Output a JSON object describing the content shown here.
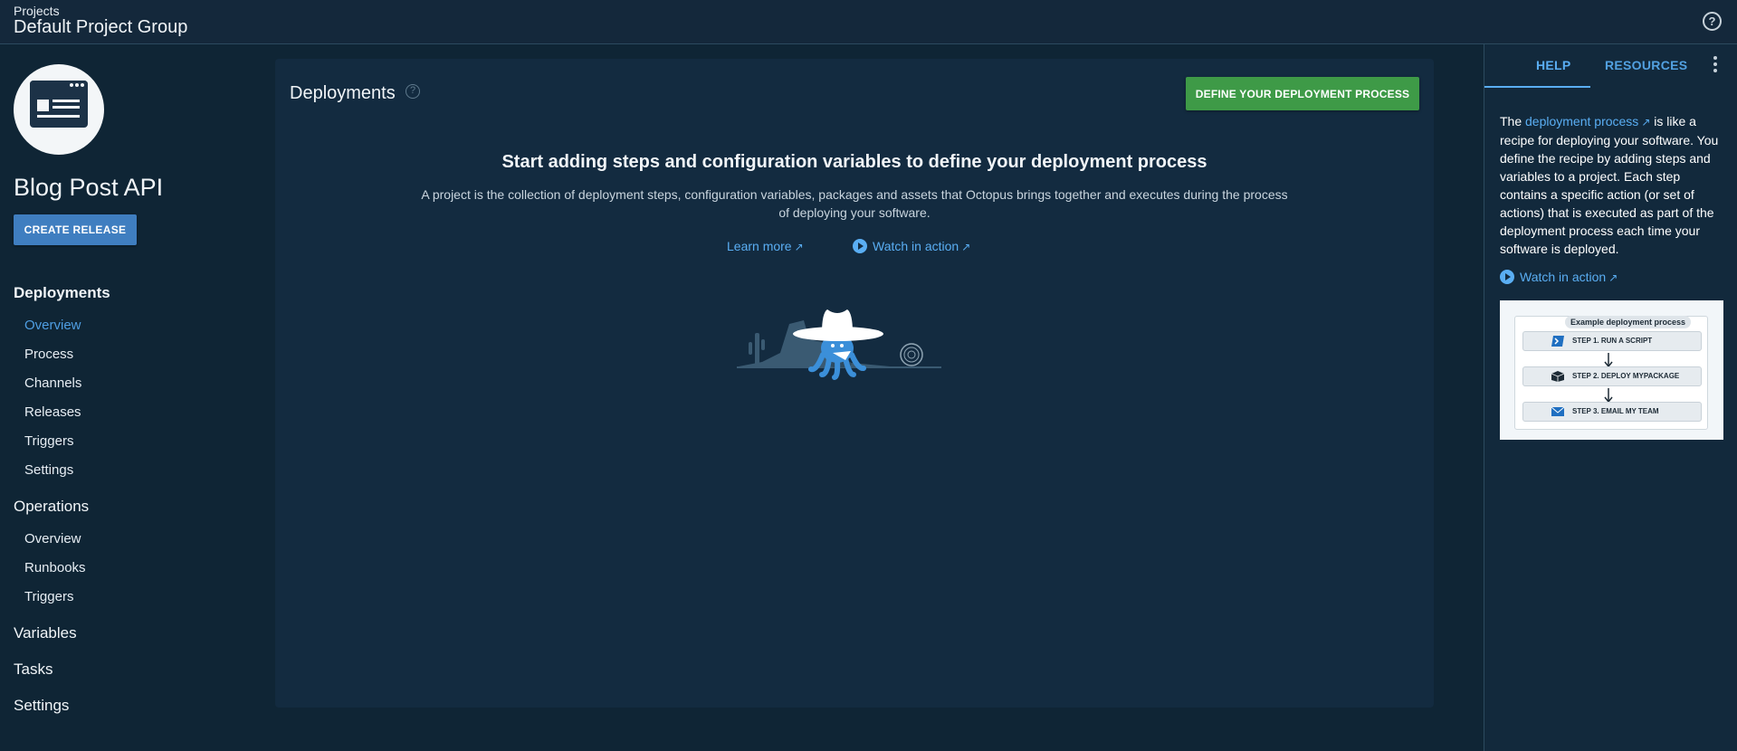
{
  "header": {
    "breadcrumb": "Projects",
    "title": "Default Project Group",
    "help_icon": "question-circle-icon"
  },
  "sidebar": {
    "project_name": "Blog Post API",
    "create_release_label": "CREATE RELEASE",
    "groups": {
      "deployments": "Deployments",
      "operations": "Operations",
      "variables": "Variables",
      "tasks": "Tasks",
      "settings": "Settings"
    },
    "deployment_items": [
      "Overview",
      "Process",
      "Channels",
      "Releases",
      "Triggers",
      "Settings"
    ],
    "operation_items": [
      "Overview",
      "Runbooks",
      "Triggers"
    ],
    "active_item": "Deployments/Overview"
  },
  "main": {
    "title": "Deployments",
    "define_button_label": "DEFINE YOUR DEPLOYMENT PROCESS",
    "heading": "Start adding steps and configuration variables to define your deployment process",
    "description": "A project is the collection of deployment steps, configuration variables, packages and assets that Octopus brings together and executes during the process of deploying your software.",
    "learn_more": "Learn more",
    "watch_in_action": "Watch in action"
  },
  "right_panel": {
    "tabs": [
      "HELP",
      "RESOURCES"
    ],
    "active_tab": "HELP",
    "help_text_prefix": "The ",
    "help_link": "deployment process",
    "help_text_suffix": " is like a recipe for deploying your software. You define the recipe by adding steps and variables to a project. Each step contains a specific action (or set of actions) that is executed as part of the deployment process each time your software is deployed.",
    "watch_in_action": "Watch in action",
    "example": {
      "title": "Example deployment process",
      "steps": [
        "STEP 1. RUN A SCRIPT",
        "STEP 2. DEPLOY MYPACKAGE",
        "STEP 3. EMAIL MY TEAM"
      ]
    }
  },
  "colors": {
    "background": "#0f2535",
    "panel": "#132b40",
    "accent_blue": "#3f7ec0",
    "link_blue": "#5aaef3",
    "accent_green": "#3e9a47"
  }
}
